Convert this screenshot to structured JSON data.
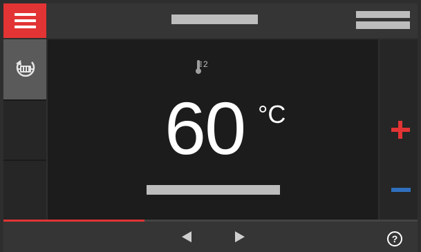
{
  "header": {
    "menu_icon": "hamburger-menu-icon"
  },
  "sidebar": {
    "mode_icon": "radiator-cycle-icon"
  },
  "main": {
    "sensor_icon": "thermometer-icon",
    "sensor_index": "2",
    "temperature_value": "60",
    "temperature_unit": "°C"
  },
  "controls": {
    "increase_icon": "plus-icon",
    "decrease_icon": "minus-icon"
  },
  "footer": {
    "progress_fraction": 0.34,
    "prev_icon": "arrow-left-icon",
    "next_icon": "arrow-right-icon",
    "help_label": "?"
  },
  "colors": {
    "accent_red": "#e23434",
    "accent_blue": "#2f6fbe",
    "placeholder_gray": "#bdbdbd"
  }
}
